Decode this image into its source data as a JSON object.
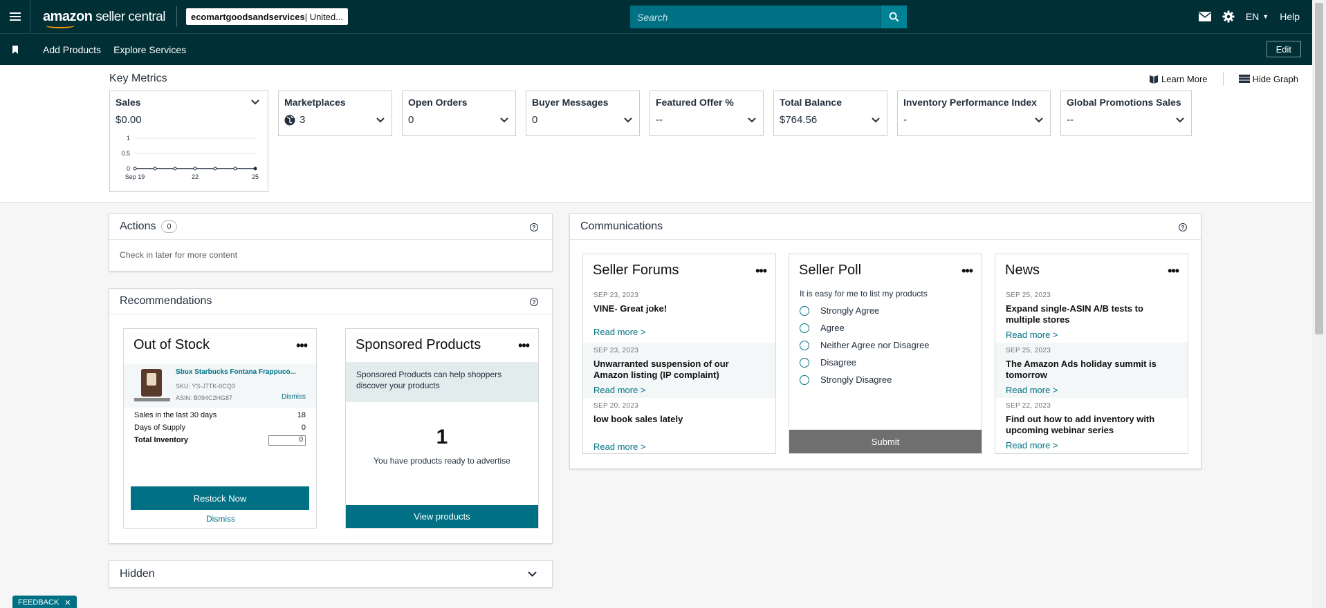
{
  "header": {
    "brand": "amazon",
    "brand_sub": " seller central",
    "store_name": "ecomartgoodsandservices",
    "store_region": " | United...",
    "search_placeholder": "Search",
    "language": "EN",
    "help": "Help"
  },
  "subnav": {
    "items": [
      "Add Products",
      "Explore Services"
    ],
    "edit": "Edit"
  },
  "key_metrics": {
    "title": "Key Metrics",
    "learn_more": "Learn More",
    "hide_graph": "Hide Graph",
    "sales": {
      "label": "Sales",
      "value": "$0.00"
    },
    "tiles": [
      {
        "label": "Marketplaces",
        "value": "3",
        "icon": "globe-icon"
      },
      {
        "label": "Open Orders",
        "value": "0"
      },
      {
        "label": "Buyer Messages",
        "value": "0"
      },
      {
        "label": "Featured Offer %",
        "value": "--"
      },
      {
        "label": "Total Balance",
        "value": "$764.56"
      },
      {
        "label": "Inventory Performance Index",
        "value": "-"
      },
      {
        "label": "Global Promotions Sales",
        "value": "--"
      }
    ]
  },
  "chart_data": {
    "type": "line",
    "x": [
      "Sep 19",
      "20",
      "21",
      "22",
      "23",
      "24",
      "25"
    ],
    "x_tick_labels": [
      "Sep 19",
      "22",
      "25"
    ],
    "y_tick_labels": [
      "1",
      "0.5",
      "0"
    ],
    "values": [
      0,
      0,
      0,
      0,
      0,
      0,
      0
    ],
    "ylim": [
      0,
      1
    ],
    "grid": true
  },
  "actions": {
    "title": "Actions",
    "count": "0",
    "empty": "Check in later for more content"
  },
  "recommendations": {
    "title": "Recommendations",
    "out_of_stock": {
      "title": "Out of Stock",
      "product_name": "Sbux Starbucks Fontana Frappuco...",
      "sku": "SKU: YS-J7TK-0CQ3",
      "asin": "ASIN: B094C2HG87",
      "dismiss_link": "Dismiss",
      "rows": [
        {
          "label": "Sales in the last 30 days",
          "value": "18"
        },
        {
          "label": "Days of Supply",
          "value": "0"
        }
      ],
      "total_label": "Total Inventory",
      "total_value": "0",
      "restock": "Restock Now",
      "dismiss": "Dismiss"
    },
    "sponsored": {
      "title": "Sponsored Products",
      "banner": "Sponsored Products can help shoppers discover your products",
      "count": "1",
      "message": "You have products ready to advertise",
      "button": "View products"
    }
  },
  "hidden": {
    "title": "Hidden"
  },
  "communications": {
    "title": "Communications",
    "forums": {
      "title": "Seller Forums",
      "items": [
        {
          "date": "SEP 23, 2023",
          "title": "VINE- Great joke!",
          "read": "Read more >"
        },
        {
          "date": "SEP 23, 2023",
          "title": "Unwarranted suspension of our Amazon listing (IP complaint)",
          "read": "Read more >"
        },
        {
          "date": "SEP 20, 2023",
          "title": "low book sales lately",
          "read": "Read more >"
        }
      ]
    },
    "poll": {
      "title": "Seller Poll",
      "question": "It is easy for me to list my products",
      "options": [
        "Strongly Agree",
        "Agree",
        "Neither Agree nor Disagree",
        "Disagree",
        "Strongly Disagree"
      ],
      "submit": "Submit"
    },
    "news": {
      "title": "News",
      "items": [
        {
          "date": "SEP 25, 2023",
          "title": "Expand single-ASIN A/B tests to multiple stores",
          "read": "Read more >"
        },
        {
          "date": "SEP 25, 2023",
          "title": "The Amazon Ads holiday summit is tomorrow",
          "read": "Read more >"
        },
        {
          "date": "SEP 22, 2023",
          "title": "Find out how to add inventory with upcoming webinar series",
          "read": "Read more >"
        }
      ]
    }
  },
  "feedback": "FEEDBACK",
  "colors": {
    "header_bg": "#002f36",
    "accent": "#007185",
    "search_bg": "#007185",
    "smile": "#ff9900"
  }
}
